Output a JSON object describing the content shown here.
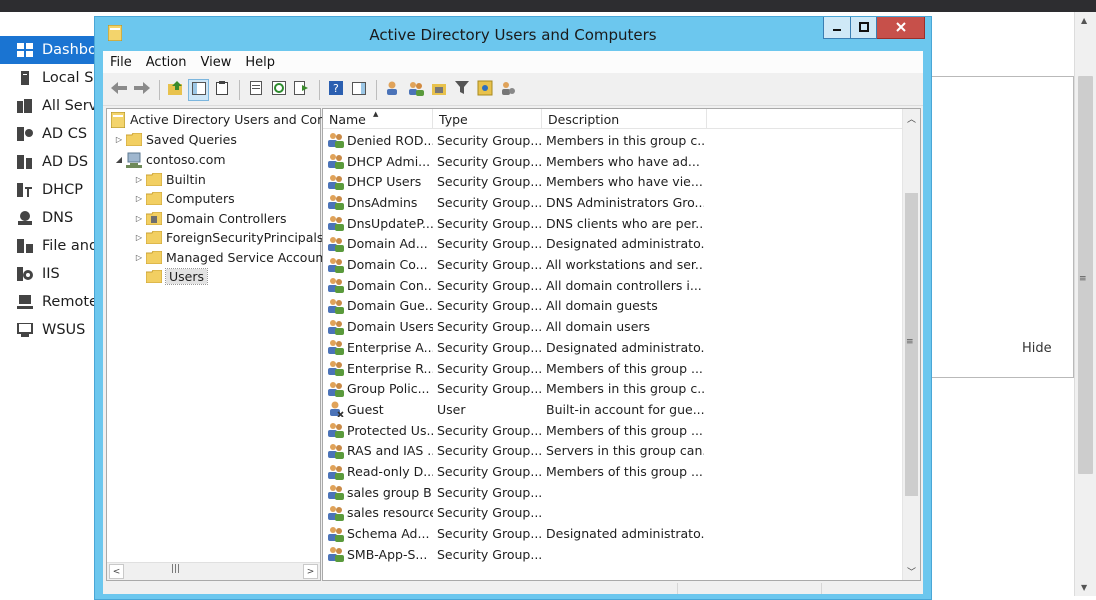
{
  "server_manager": {
    "nav": [
      {
        "label": "Dashboard",
        "icon": "dashboard-icon",
        "active": true
      },
      {
        "label": "Local Server",
        "icon": "local-server-icon"
      },
      {
        "label": "All Servers",
        "icon": "all-servers-icon"
      },
      {
        "label": "AD CS",
        "icon": "ad-cs-icon"
      },
      {
        "label": "AD DS",
        "icon": "ad-ds-icon"
      },
      {
        "label": "DHCP",
        "icon": "dhcp-icon"
      },
      {
        "label": "DNS",
        "icon": "dns-icon"
      },
      {
        "label": "File and Storage Services",
        "icon": "file-storage-icon"
      },
      {
        "label": "IIS",
        "icon": "iis-icon"
      },
      {
        "label": "Remote Access",
        "icon": "remote-access-icon"
      },
      {
        "label": "WSUS",
        "icon": "wsus-icon"
      }
    ],
    "hide_label": "Hide"
  },
  "window": {
    "title": "Active Directory Users and Computers",
    "accent": "#6cc7ee",
    "close_color": "#c7504a"
  },
  "menu": [
    "File",
    "Action",
    "View",
    "Help"
  ],
  "tree": {
    "root": "Active Directory Users and Computers",
    "saved_queries": "Saved Queries",
    "domain": "contoso.com",
    "children": [
      "Builtin",
      "Computers",
      "Domain Controllers",
      "ForeignSecurityPrincipals",
      "Managed Service Accounts",
      "Users"
    ],
    "selected": "Users"
  },
  "list": {
    "columns": [
      "Name",
      "Type",
      "Description"
    ],
    "rows": [
      {
        "name": "Denied ROD...",
        "type": "Security Group...",
        "desc": "Members in this group c...",
        "icon": "group-icon"
      },
      {
        "name": "DHCP Admi...",
        "type": "Security Group...",
        "desc": "Members who have ad...",
        "icon": "group-icon"
      },
      {
        "name": "DHCP Users",
        "type": "Security Group...",
        "desc": "Members who have vie...",
        "icon": "group-icon"
      },
      {
        "name": "DnsAdmins",
        "type": "Security Group...",
        "desc": "DNS Administrators Gro...",
        "icon": "group-icon"
      },
      {
        "name": "DnsUpdateP...",
        "type": "Security Group...",
        "desc": "DNS clients who are per...",
        "icon": "group-icon"
      },
      {
        "name": "Domain Ad...",
        "type": "Security Group...",
        "desc": "Designated administrato...",
        "icon": "group-icon"
      },
      {
        "name": "Domain Co...",
        "type": "Security Group...",
        "desc": "All workstations and ser...",
        "icon": "group-icon"
      },
      {
        "name": "Domain Con...",
        "type": "Security Group...",
        "desc": "All domain controllers i...",
        "icon": "group-icon"
      },
      {
        "name": "Domain Gue...",
        "type": "Security Group...",
        "desc": "All domain guests",
        "icon": "group-icon"
      },
      {
        "name": "Domain Users",
        "type": "Security Group...",
        "desc": "All domain users",
        "icon": "group-icon"
      },
      {
        "name": "Enterprise A...",
        "type": "Security Group...",
        "desc": "Designated administrato...",
        "icon": "group-icon"
      },
      {
        "name": "Enterprise R...",
        "type": "Security Group...",
        "desc": "Members of this group ...",
        "icon": "group-icon"
      },
      {
        "name": "Group Polic...",
        "type": "Security Group...",
        "desc": "Members in this group c...",
        "icon": "group-icon"
      },
      {
        "name": "Guest",
        "type": "User",
        "desc": "Built-in account for gue...",
        "icon": "user-icon"
      },
      {
        "name": "Protected Us...",
        "type": "Security Group...",
        "desc": "Members of this group ...",
        "icon": "group-icon"
      },
      {
        "name": "RAS and IAS ...",
        "type": "Security Group...",
        "desc": "Servers in this group can...",
        "icon": "group-icon"
      },
      {
        "name": "Read-only D...",
        "type": "Security Group...",
        "desc": "Members of this group ...",
        "icon": "group-icon"
      },
      {
        "name": "sales group B",
        "type": "Security Group...",
        "desc": "",
        "icon": "group-icon"
      },
      {
        "name": "sales resource",
        "type": "Security Group...",
        "desc": "",
        "icon": "group-icon"
      },
      {
        "name": "Schema Ad...",
        "type": "Security Group...",
        "desc": "Designated administrato...",
        "icon": "group-icon"
      },
      {
        "name": "SMB-App-S...",
        "type": "Security Group...",
        "desc": "",
        "icon": "group-icon"
      }
    ]
  }
}
